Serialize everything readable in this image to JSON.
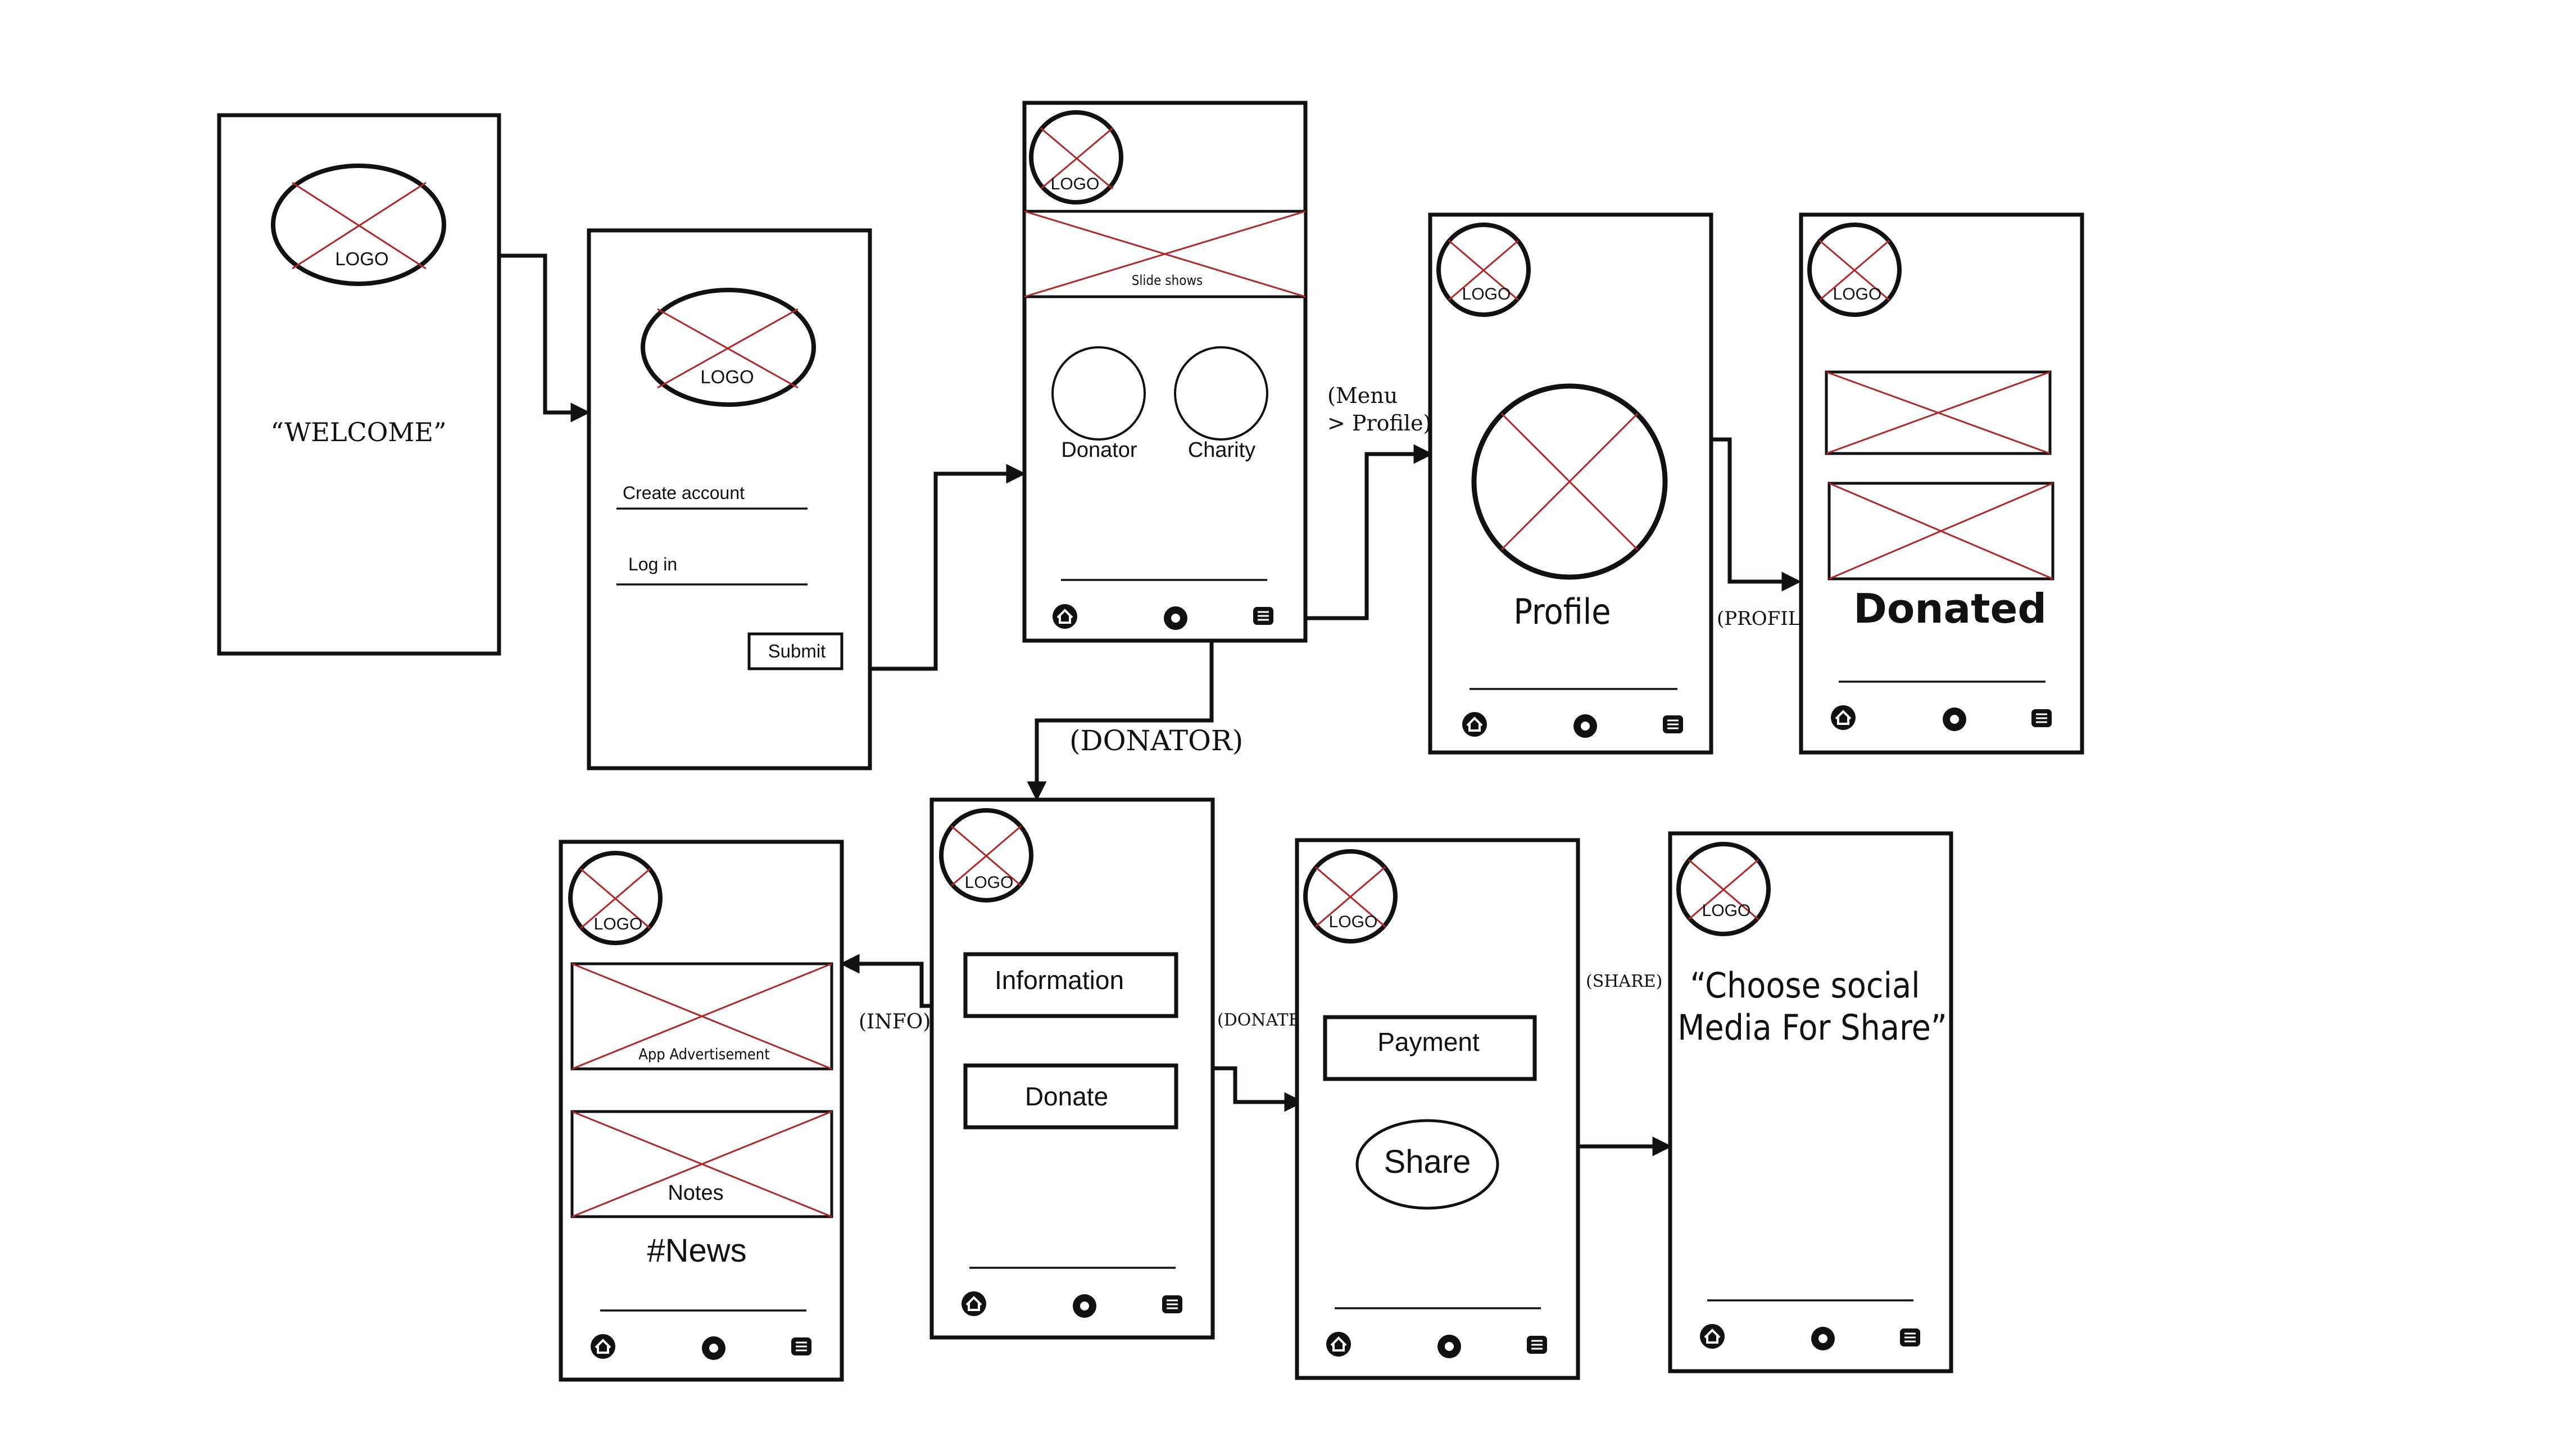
{
  "colors": {
    "stroke": "#111111",
    "placeholder_cross": "#b3262a",
    "background": "#fdfdfd"
  },
  "nav_icons": [
    "home-icon",
    "record-icon",
    "menu-icon"
  ],
  "screens": {
    "welcome": {
      "logo": "LOGO",
      "welcome_text": "“WELCOME”"
    },
    "login": {
      "logo": "LOGO",
      "create_account": "Create account",
      "log_in": "Log in",
      "submit": "Submit"
    },
    "home": {
      "logo": "LOGO",
      "slideshow": "Slide shows",
      "donator": "Donator",
      "charity": "Charity"
    },
    "profile": {
      "logo": "LOGO",
      "profile_label": "Profile"
    },
    "donated": {
      "logo": "LOGO",
      "donated_label": "Donated"
    },
    "news": {
      "logo": "LOGO",
      "ad_label": "App Advertisement",
      "notes_label": "Notes",
      "news_label": "#News"
    },
    "donator": {
      "logo": "LOGO",
      "information": "Information",
      "donate": "Donate"
    },
    "payment": {
      "logo": "LOGO",
      "payment": "Payment",
      "share": "Share"
    },
    "share": {
      "logo": "LOGO",
      "line1": "“Choose social",
      "line2": "Media For Share”"
    }
  },
  "transitions": {
    "menu_line1": "(Menu",
    "menu_line2": "> Profile)",
    "profile": "(PROFILE)",
    "donator": "(DONATOR)",
    "info": "(INFO)",
    "donate": "(DONATE)",
    "share": "(SHARE)"
  }
}
